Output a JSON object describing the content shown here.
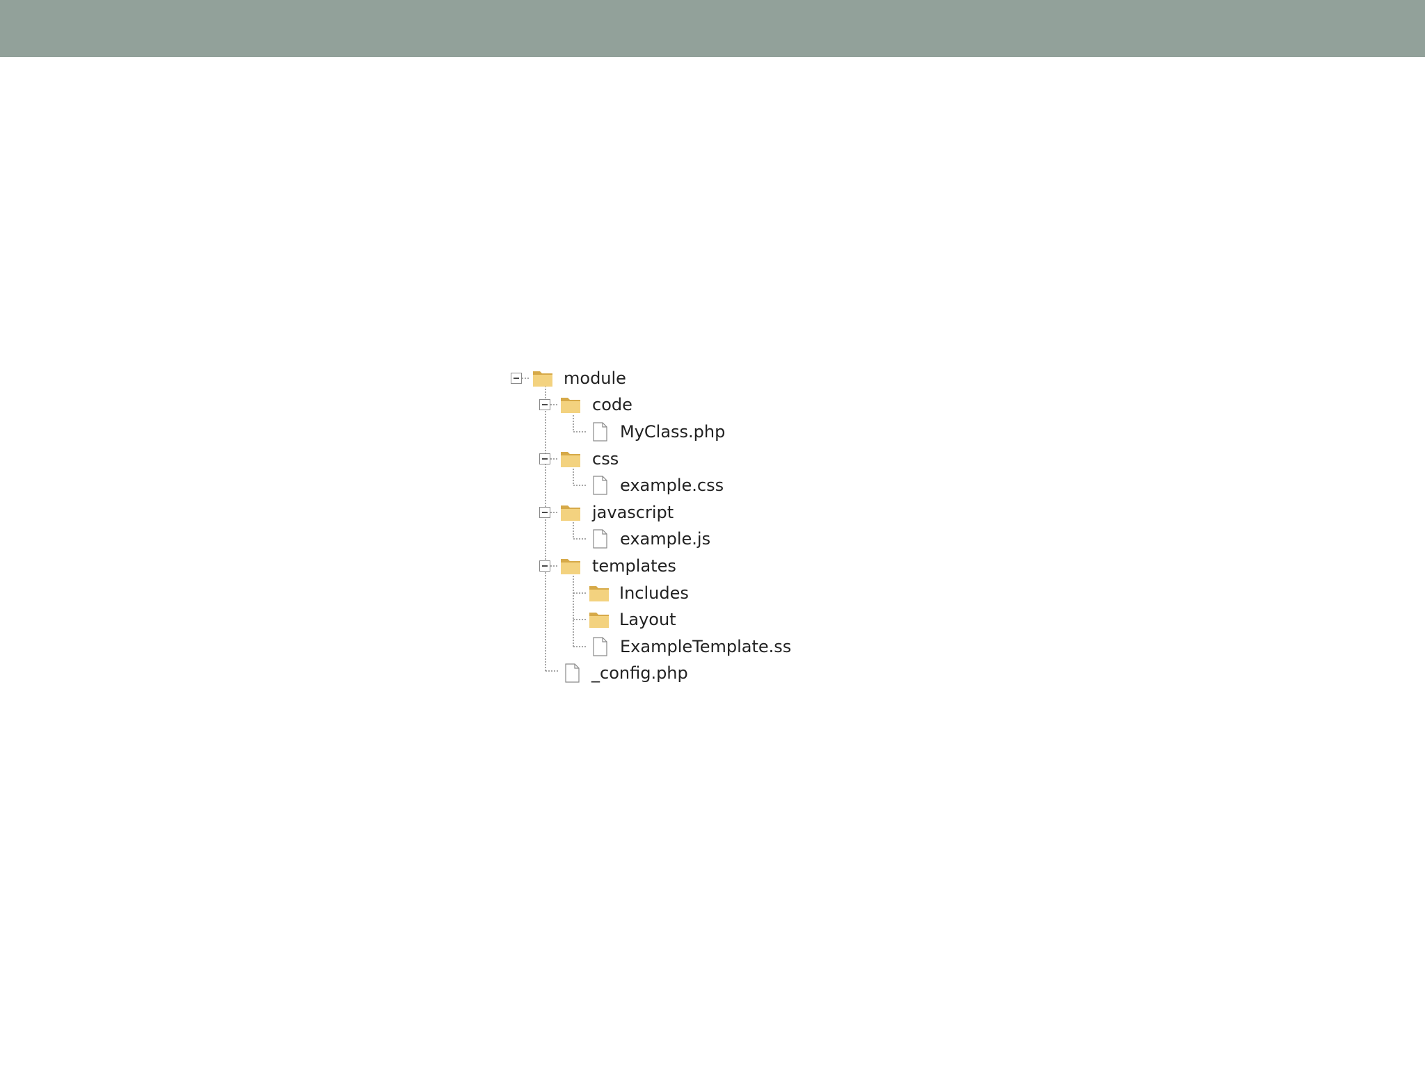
{
  "colors": {
    "top_bar": "#92a19a",
    "folder_front": "#f3d27f",
    "folder_back": "#d6a948",
    "file": "#ffffff",
    "line": "#8a8a8a"
  },
  "tree": {
    "root": {
      "label": "module",
      "icon": "folder-icon",
      "expanded": true
    },
    "code": {
      "label": "code",
      "icon": "folder-icon",
      "expanded": true
    },
    "myclass": {
      "label": "MyClass.php",
      "icon": "file-icon"
    },
    "css": {
      "label": "css",
      "icon": "folder-icon",
      "expanded": true
    },
    "example_css": {
      "label": "example.css",
      "icon": "file-icon"
    },
    "javascript": {
      "label": "javascript",
      "icon": "folder-icon",
      "expanded": true
    },
    "example_js": {
      "label": "example.js",
      "icon": "file-icon"
    },
    "templates": {
      "label": "templates",
      "icon": "folder-icon",
      "expanded": true
    },
    "includes": {
      "label": "Includes",
      "icon": "folder-icon"
    },
    "layout": {
      "label": "Layout",
      "icon": "folder-icon"
    },
    "example_template": {
      "label": "ExampleTemplate.ss",
      "icon": "file-icon"
    },
    "config": {
      "label": "_config.php",
      "icon": "file-icon"
    }
  }
}
